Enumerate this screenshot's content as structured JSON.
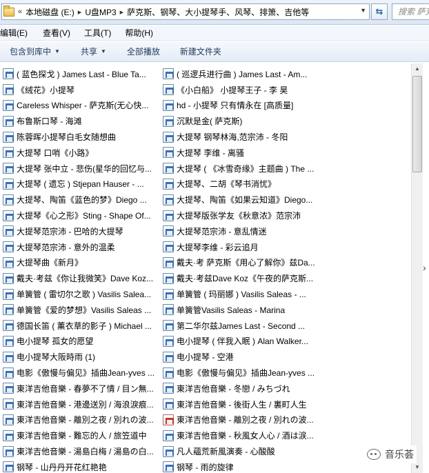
{
  "address": {
    "crumbs": [
      "本地磁盘 (E:)",
      "U盘MP3",
      "萨克斯、钢琴、大小提琴手、风琴、排箫、吉他等"
    ],
    "search_placeholder": "搜索 萨克"
  },
  "menu": [
    "编辑(E)",
    "查看(V)",
    "工具(T)",
    "帮助(H)"
  ],
  "toolbar": {
    "include_library": "包含到库中",
    "share": "共享",
    "play_all": "全部播放",
    "new_folder": "新建文件夹"
  },
  "files_left": [
    "( 蓝色探戈 ) James Last - Blue Ta...",
    "《绒花》小提琴",
    "Careless Whisper - 萨克斯(无心快...",
    "布鲁斯口琴 - 海滩",
    "陈蓉晖小提琴白毛女随想曲",
    "大提琴 口哨《小路》",
    "大提琴 张中立 - 悲伤(星华的回忆与...",
    "大提琴 ( 遗忘 ) Stjepan Hauser - ...",
    "大提琴、陶笛《蓝色的梦》Diego ...",
    "大提琴《心之形》Sting - Shape Of...",
    "大提琴范宗沛 - 巴哈的大提琴",
    "大提琴范宗沛 - 意外的温柔",
    "大提琴曲《新月》",
    "戴夫·考兹《你让我微笑》Dave Koz...",
    "单簧管 ( 雷切尔之歌 ) Vasilis Salea...",
    "单簧管《爱的梦想》Vasilis Saleas ...",
    "德国长笛 ( 薰衣草的影子 ) Michael ...",
    "电小提琴 孤女的愿望",
    "电小提琴大阪時雨 (1)",
    "电影《傲慢与偏见》插曲Jean-yves ...",
    "東洋吉他音樂 - 春夢不了情 / 目ン無...",
    "東洋吉他音樂 - 港邊送別 / 海浪淚痕...",
    "東洋吉他音樂 - 離別之夜 / 別れの波...",
    "東洋吉他音樂 - 難忘的人 / 旅笠道中",
    "東洋吉他音樂 - 湯島白梅 / 湯島の白...",
    "钢琴 - 山丹丹开花红艳艳"
  ],
  "files_right": [
    "( 巡逻兵进行曲 ) James Last - Am...",
    "《小白船》 小提琴王子 - 李 昊",
    "hd - 小提琴 只有情永在 [高质量]",
    "沉默是金( 萨克斯)",
    "大提琴 钢琴林海,范宗沛 - 冬阳",
    "大提琴 李维 - 离骚",
    "大提琴 ( 《冰雪奇缘》主题曲 ) The ...",
    "大提琴、二胡《琴书消忧》",
    "大提琴、陶笛《如果云知道》Diego...",
    "大提琴版张学友《秋意浓》范宗沛",
    "大提琴范宗沛 - 意乱情迷",
    "大提琴李维 - 彩云追月",
    "戴夫·考 萨克斯《用心了解你》兹Da...",
    "戴夫·考兹Dave Koz《午夜的萨克斯...",
    "单簧管 ( 玛丽娜 ) Vasilis Saleas - ...",
    "单簧管Vasilis Saleas - Marina",
    "第二华尔兹James Last - Second ...",
    "电小提琴 ( 伴我入眠 ) Alan Walker...",
    "电小提琴 - 空港",
    "电影《傲慢与偏见》插曲Jean-yves ...",
    "東洋吉他音樂 - 冬戀 / みちづれ",
    "東洋吉他音樂 - 後街人生 / 裏町人生",
    "東洋吉他音樂 - 離別之夜 / 別れの波...",
    "東洋吉他音樂 - 秋風女人心 / 酒は涙...",
    "凡人蘊荒新風演奏 - 心酸酸",
    "钢琴 - 雨的旋律"
  ],
  "watermark": "音乐荟",
  "colors": {
    "accent": "#1e395b",
    "link_blue": "#2a5ea8"
  }
}
